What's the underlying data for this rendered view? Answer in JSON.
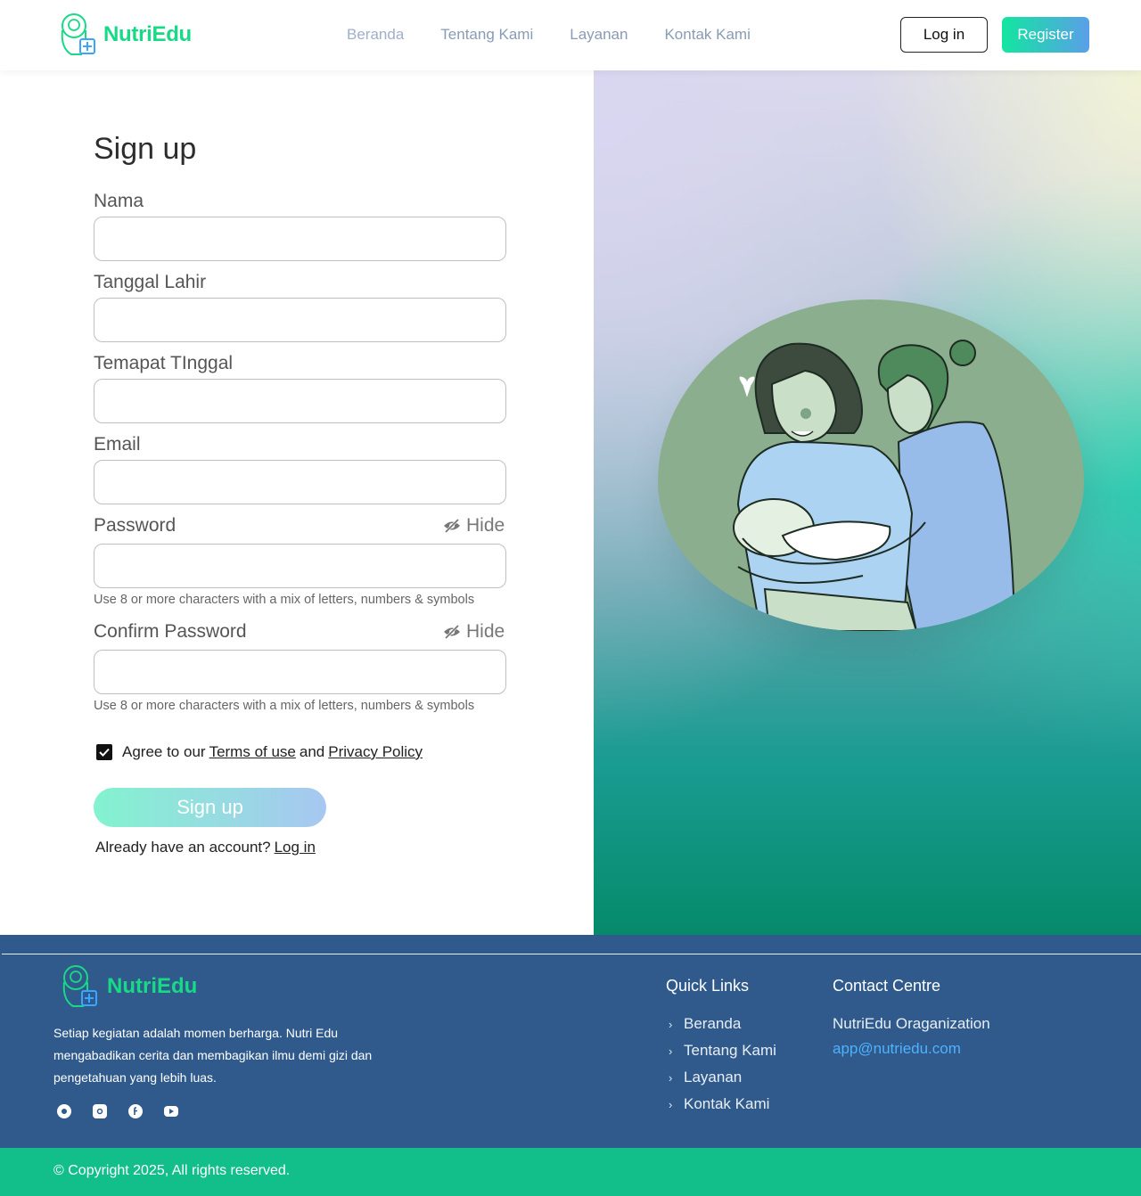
{
  "header": {
    "brand": "NutriEdu",
    "nav": [
      "Beranda",
      "Tentang Kami",
      "Layanan",
      "Kontak Kami"
    ],
    "login_label": "Log in",
    "register_label": "Register"
  },
  "form": {
    "title": "Sign up",
    "fields": {
      "nama": {
        "label": "Nama",
        "value": ""
      },
      "tanggal": {
        "label": "Tanggal Lahir",
        "value": ""
      },
      "tempat": {
        "label": "Temapat TInggal",
        "value": ""
      },
      "email": {
        "label": "Email",
        "value": ""
      },
      "password": {
        "label": "Password",
        "value": "",
        "toggle": "Hide",
        "hint": "Use 8 or more characters with a mix of letters, numbers & symbols"
      },
      "confirm": {
        "label": "Confirm Password",
        "value": "",
        "toggle": "Hide",
        "hint": "Use 8 or more characters with a mix of letters, numbers & symbols"
      }
    },
    "agree": {
      "checked": true,
      "prefix": "Agree to our",
      "terms": "Terms of use",
      "and": "and",
      "privacy": "Privacy Policy"
    },
    "submit_label": "Sign up",
    "already_text": "Already have an account?",
    "login_link": "Log in"
  },
  "footer": {
    "brand": "NutriEdu",
    "description": "Setiap kegiatan adalah momen berharga. Nutri Edu mengabadikan cerita dan membagikan ilmu demi gizi dan pengetahuan yang lebih luas.",
    "social": [
      "whatsapp-icon",
      "instagram-icon",
      "facebook-icon",
      "youtube-icon"
    ],
    "quick_links_title": "Quick Links",
    "quick_links": [
      "Beranda",
      "Tentang Kami",
      "Layanan",
      "Kontak Kami"
    ],
    "contact_title": "Contact Centre",
    "contact_org": "NutriEdu Oraganization",
    "contact_email": "app@nutriedu.com",
    "copyright": "© Copyright 2025, All rights reserved."
  },
  "colors": {
    "brand_green": "#17d986",
    "footer_blue": "#2f5a8b",
    "bottom_bar": "#12bf8a",
    "link_blue": "#4db2ff"
  }
}
